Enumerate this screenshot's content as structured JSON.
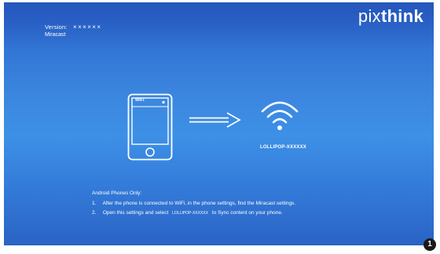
{
  "header": {
    "version_label": "Version:",
    "version_value": "××××××",
    "mode": "Miracast",
    "logo_light": "pix",
    "logo_bold": "think"
  },
  "diagram": {
    "phone_wifi_label": "WiFi",
    "ssid": "LOLLIPOP-XXXXXX"
  },
  "instructions": {
    "heading": "Android Phones Only:",
    "step1_num": "1.",
    "step1_text": "After the phone is connected to WiFi, in the phone settings, find the Miracast settings.",
    "step2_num": "2.",
    "step2_before": "Open this settings and select",
    "step2_ssid": "LOLLIPOP-XXXXXX",
    "step2_after": "to Sync content on your phone."
  },
  "callout": {
    "number": "1"
  },
  "colors": {
    "background_top": "#2d63c8",
    "background_mid": "#3d90e6",
    "foreground": "#ffffff",
    "callout": "#1a1a1a"
  },
  "icons": [
    "phone-icon",
    "arrow-right-icon",
    "wifi-icon"
  ]
}
